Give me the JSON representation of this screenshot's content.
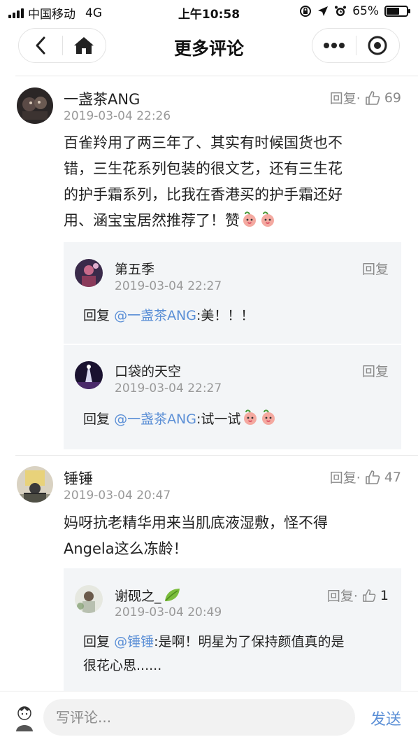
{
  "status_bar": {
    "carrier": "中国移动",
    "network": "4G",
    "time": "上午10:58",
    "battery": "65%",
    "battery_level": 0.65
  },
  "nav": {
    "title": "更多评论",
    "back_icon": "chevron-left-icon",
    "home_icon": "home-icon",
    "more_icon": "more-dots-icon",
    "close_icon": "target-circle-icon"
  },
  "comments": [
    {
      "author": "一盏茶ANG",
      "time": "2019-03-04 22:26",
      "reply_label": "回复·",
      "likes": "69",
      "text": "百雀羚用了两三年了、其实有时候国货也不错，三生花系列包装的很文艺，还有三生花的护手霜系列，比我在香港买的护手霜还好用、涵宝宝居然推荐了！赞",
      "text_lines": [
        "百雀羚用了两三年了、其实有时候国货也不",
        "错，三生花系列包装的很文艺，还有三生花",
        "的护手霜系列，比我在香港买的护手霜还好",
        "用、涵宝宝居然推荐了！赞"
      ],
      "emoji": "peach-face-emoji",
      "replies": [
        {
          "author": "第五季",
          "time": "2019-03-04 22:27",
          "reply_label": "回复",
          "prefix": "回复",
          "mention": "@一盏茶ANG",
          "text": ":美！！！"
        },
        {
          "author": "口袋的天空",
          "time": "2019-03-04 22:27",
          "reply_label": "回复",
          "prefix": "回复",
          "mention": "@一盏茶ANG",
          "text": ":试一试"
        }
      ]
    },
    {
      "author": "锤锤",
      "time": "2019-03-04 20:47",
      "reply_label": "回复·",
      "likes": "47",
      "text_lines": [
        "妈呀抗老精华用来当肌底液湿敷，怪不得",
        "Angela这么冻龄！"
      ],
      "replies": [
        {
          "author": "谢砚之_",
          "time": "2019-03-04 20:49",
          "reply_label": "回复·",
          "likes": "1",
          "prefix": "回复",
          "mention": "@锤锤",
          "text_lines": [
            ":是啊！明星为了保持颜值真的是",
            "很花心思......"
          ]
        }
      ]
    }
  ],
  "bottom_bar": {
    "placeholder": "写评论...",
    "send_label": "发送"
  },
  "colors": {
    "accent": "#5b8fd6",
    "reply_bg": "#f3f5f7",
    "muted": "#9a9a9a"
  }
}
